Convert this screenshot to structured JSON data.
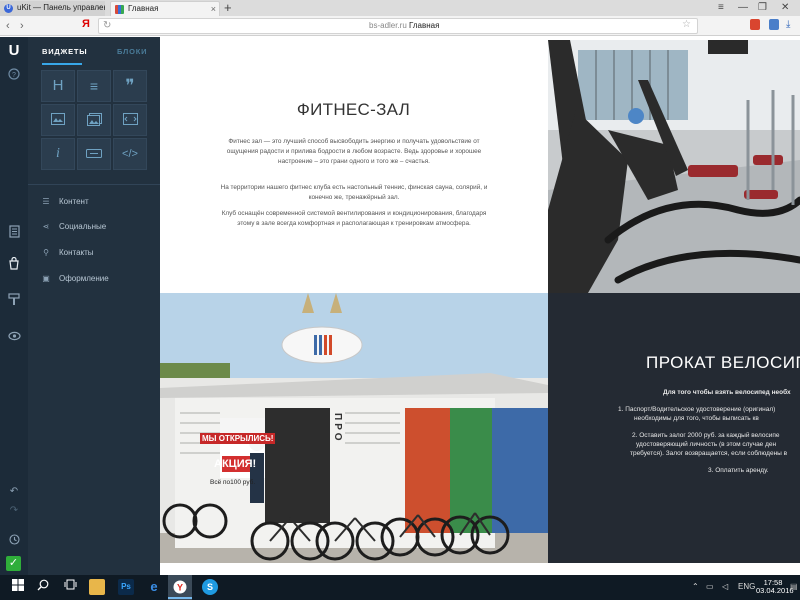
{
  "browser": {
    "tabs": [
      {
        "title": "uKit — Панель управления",
        "icon": "ukit-favicon",
        "icon_letter": "U"
      },
      {
        "title": "Главная",
        "icon": "site-favicon"
      }
    ],
    "tab_close": "×",
    "new_tab": "+",
    "window_controls": [
      "≡",
      "—",
      "❐",
      "✕"
    ],
    "nav": {
      "back": "‹",
      "forward": "›",
      "yandex": "Я",
      "reload": "↻"
    },
    "url_domain": "bs-adler.ru",
    "url_title": "Главная",
    "star": "☆"
  },
  "rail": {
    "logo": "U",
    "icons": [
      "help-icon",
      "pages-icon",
      "store-icon",
      "design-icon",
      "preview-icon",
      "undo-icon",
      "redo-icon",
      "history-icon",
      "publish-check-icon"
    ]
  },
  "panel": {
    "tab_widgets": "ВИДЖЕТЫ",
    "tab_blocks": "БЛОКИ",
    "widgets": [
      {
        "icon": "heading-icon",
        "glyph": "H"
      },
      {
        "icon": "text-icon",
        "glyph": "≡"
      },
      {
        "icon": "quote-icon",
        "glyph": "❞"
      },
      {
        "icon": "image-icon",
        "glyph": ""
      },
      {
        "icon": "gallery-icon",
        "glyph": ""
      },
      {
        "icon": "slider-icon",
        "glyph": ""
      },
      {
        "icon": "info-icon",
        "glyph": "i"
      },
      {
        "icon": "button-icon",
        "glyph": ""
      },
      {
        "icon": "code-icon",
        "glyph": "</>"
      }
    ],
    "menu": [
      {
        "label": "Контент",
        "icon": "content-icon",
        "glyph": "☰"
      },
      {
        "label": "Социальные",
        "icon": "share-icon",
        "glyph": "⋖"
      },
      {
        "label": "Контакты",
        "icon": "location-pin-icon",
        "glyph": "⚲"
      },
      {
        "label": "Оформление",
        "icon": "palette-icon",
        "glyph": "▣"
      }
    ]
  },
  "page": {
    "fitness": {
      "title": "ФИТНЕС-ЗАЛ",
      "p1": "Фитнес зал — это лучший способ высвободить энергию и получать удовольствие от ощущения радости и прилива бодрости в любом возрасте. Ведь здоровье и хорошее настроение – это грани одного и того же – счастья.",
      "p2": "На территории нашего фитнес клуба есть настольный теннис, финская сауна, солярий, и конечно же, тренажёрный зал.",
      "p3": "Клуб оснащён современной системой вентилирования и кондиционирования, благодаря этому в зале всегда комфортная и располагающая к тренировкам атмосфера."
    },
    "shop_photo": {
      "banner1": "МЫ ОТКРЫЛИСЬ!",
      "banner2": "АКЦИЯ!",
      "banner3": "Всё по100 руб.",
      "sign": "ПРО"
    },
    "bike": {
      "title": "ПРОКАТ ВЕЛОСИП",
      "intro": "Для того чтобы взять велосипед необх",
      "l1": "1. Паспорт/Водительское удостоверение (оригинал)",
      "l2": "необходимы для того, чтобы выписать кв",
      "l3": "2. Оставить залог 2000 руб. за каждый велосипе",
      "l4": "удостоверяющий личность (в этом случае ден",
      "l5": "требуется). Залог возвращается, если соблюдены в",
      "l6": "3. Оплатить аренду."
    }
  },
  "taskbar": {
    "apps": [
      "windows-start-icon",
      "search-icon",
      "task-view-icon",
      "file-explorer-icon",
      "photoshop-icon",
      "edge-icon",
      "yandex-browser-icon",
      "skype-icon"
    ],
    "photoshop_label": "Ps",
    "lang": "ENG",
    "time": "17:58",
    "date": "03.04.2016"
  }
}
